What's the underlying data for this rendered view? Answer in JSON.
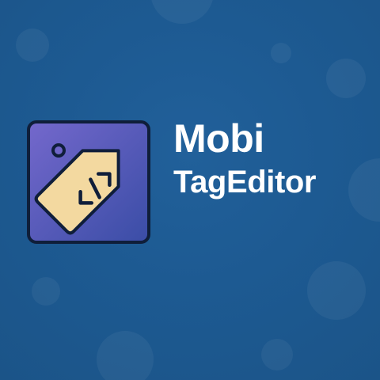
{
  "brand": {
    "name_line1": "Mobi",
    "name_line2": "TagEditor",
    "icon": "code-tag-icon"
  },
  "colors": {
    "background": "#1d5a92",
    "icon_bg_top": "#6f66c8",
    "icon_bg_bottom": "#3a4fa8",
    "icon_border": "#0f1e3a",
    "tag_fill": "#f3d9a0",
    "text": "#ffffff"
  }
}
